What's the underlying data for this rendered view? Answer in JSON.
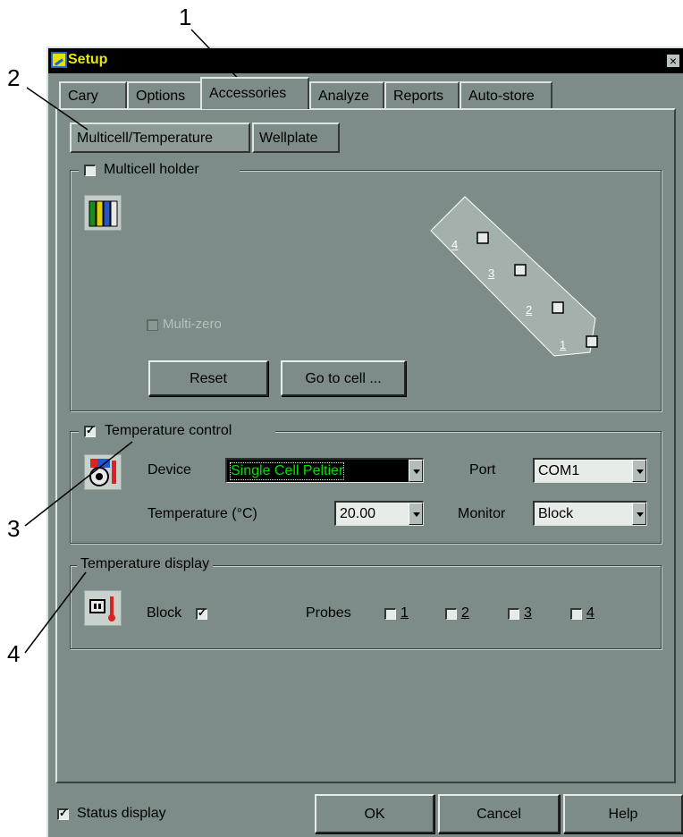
{
  "callouts": [
    "1",
    "2",
    "3",
    "4"
  ],
  "window": {
    "title": "Setup",
    "close_glyph": "×"
  },
  "tabs": [
    {
      "label": "Cary"
    },
    {
      "label": "Options"
    },
    {
      "label": "Accessories",
      "active": true
    },
    {
      "label": "Analyze"
    },
    {
      "label": "Reports"
    },
    {
      "label": "Auto-store"
    }
  ],
  "subtabs": [
    {
      "label": "Multicell/Temperature",
      "active": true
    },
    {
      "label": "Wellplate"
    }
  ],
  "multicell": {
    "checkbox_label": "Multicell holder",
    "checked": false,
    "multizero_label": "Multi-zero",
    "reset_label": "Reset",
    "goto_label": "Go to cell ...",
    "cells": [
      "4",
      "3",
      "2",
      "1"
    ]
  },
  "temperature_control": {
    "checkbox_label": "Temperature control",
    "checked": true,
    "device_label": "Device",
    "device_value": "Single Cell Peltier",
    "port_label": "Port",
    "port_value": "COM1",
    "temperature_label": "Temperature (°C)",
    "temperature_value": "20.00",
    "monitor_label": "Monitor",
    "monitor_value": "Block"
  },
  "temperature_display": {
    "title": "Temperature display",
    "block_label": "Block",
    "block_checked": true,
    "probes_label": "Probes",
    "probes": [
      "1",
      "2",
      "3",
      "4"
    ]
  },
  "footer": {
    "status_display_label": "Status display",
    "status_display_checked": true,
    "ok_label": "OK",
    "cancel_label": "Cancel",
    "help_label": "Help"
  },
  "colors": {
    "dialog_bg": "#7d8c88",
    "title_bar": "#000000",
    "title_text": "#e8e800",
    "device_field_bg": "#000000",
    "device_field_text": "#00e000",
    "temp_icon_red": "#dd2222"
  }
}
